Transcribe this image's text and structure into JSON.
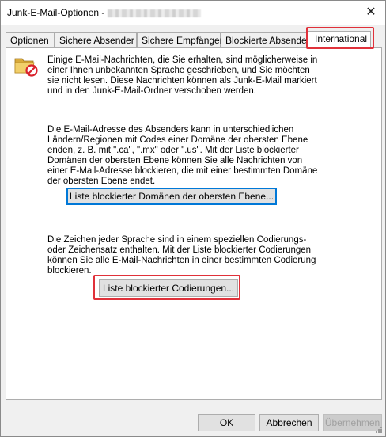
{
  "window": {
    "title": "Junk-E-Mail-Optionen -",
    "close_glyph": "✕"
  },
  "tabs": [
    {
      "label": "Optionen"
    },
    {
      "label": "Sichere Absender"
    },
    {
      "label": "Sichere Empfänger"
    },
    {
      "label": "Blockierte Absender"
    },
    {
      "label": "International",
      "active": true
    }
  ],
  "panel": {
    "icon": "junk-folder-icon",
    "intro_text": "Einige E-Mail-Nachrichten, die Sie erhalten, sind möglicherweise in einer Ihnen unbekannten Sprache geschrieben, und Sie möchten sie nicht lesen. Diese Nachrichten können als Junk-E-Mail markiert und in den Junk-E-Mail-Ordner verschoben werden.",
    "domains_text": "Die E-Mail-Adresse des Absenders kann in unterschiedlichen Ländern/Regionen mit Codes einer Domäne der obersten Ebene enden, z. B. mit \".ca\", \".mx\" oder \".us\". Mit der Liste blockierter Domänen der obersten Ebene können Sie alle Nachrichten von einer E-Mail-Adresse blockieren, die mit einer bestimmten Domäne der obersten Ebene endet.",
    "domains_button": "Liste blockierter Domänen der obersten Ebene...",
    "encodings_text": "Die Zeichen jeder Sprache sind in einem speziellen Codierungs- oder Zeichensatz enthalten. Mit der Liste blockierter Codierungen können Sie alle E-Mail-Nachrichten in einer bestimmten Codierung blockieren.",
    "encodings_button": "Liste blockierter Codierungen..."
  },
  "footer": {
    "ok": "OK",
    "cancel": "Abbrechen",
    "apply": "Übernehmen"
  },
  "colors": {
    "highlight": "#e0313a",
    "focus": "#0078d7",
    "no_entry": "#d9232d",
    "folder": "#e8c35a"
  }
}
